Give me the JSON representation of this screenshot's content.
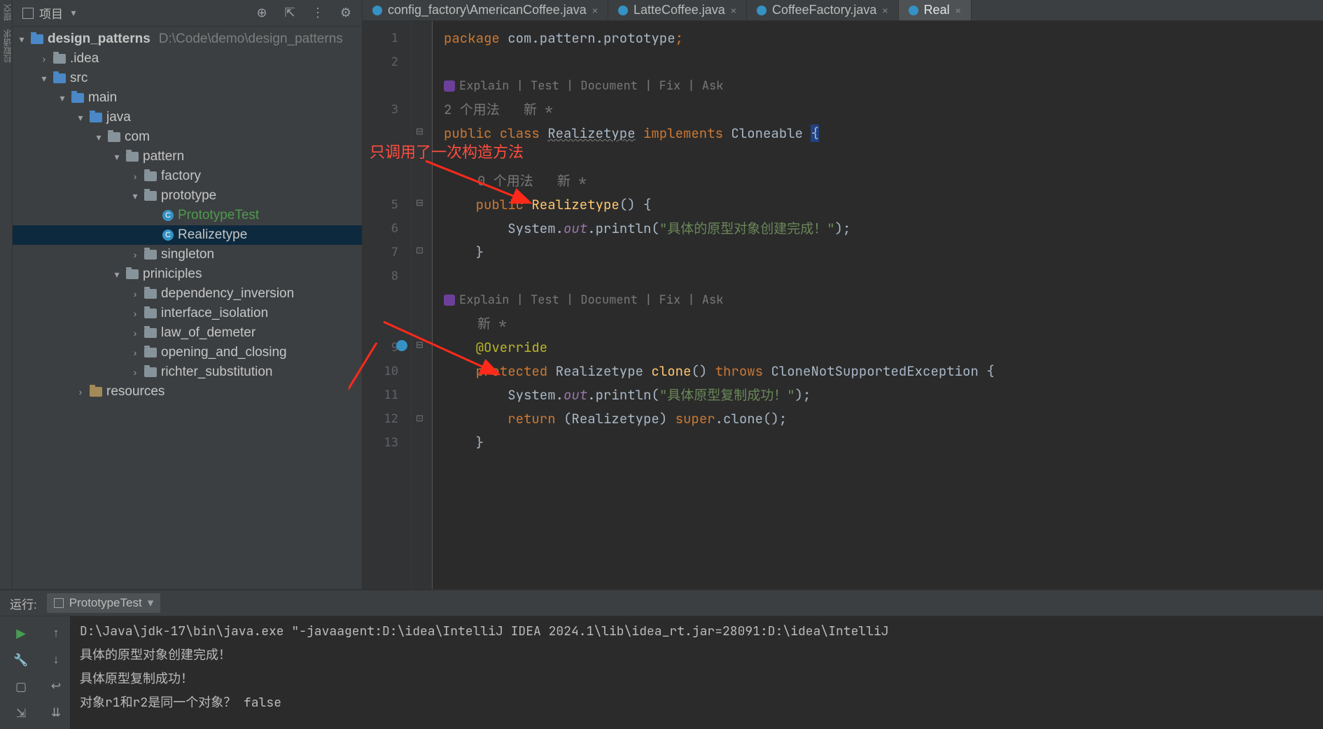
{
  "projectToolbar": {
    "title": "项目"
  },
  "projectTree": {
    "root": {
      "name": "design_patterns",
      "path": "D:\\Code\\demo\\design_patterns"
    },
    "items": [
      {
        "depth": 1,
        "chev": ">",
        "type": "folder",
        "name": ".idea"
      },
      {
        "depth": 1,
        "chev": "v",
        "type": "folder-blue",
        "name": "src"
      },
      {
        "depth": 2,
        "chev": "v",
        "type": "folder-blue",
        "name": "main"
      },
      {
        "depth": 3,
        "chev": "v",
        "type": "folder-blue",
        "name": "java"
      },
      {
        "depth": 4,
        "chev": "v",
        "type": "folder",
        "name": "com"
      },
      {
        "depth": 5,
        "chev": "v",
        "type": "folder",
        "name": "pattern"
      },
      {
        "depth": 6,
        "chev": ">",
        "type": "folder",
        "name": "factory"
      },
      {
        "depth": 6,
        "chev": "v",
        "type": "folder",
        "name": "prototype"
      },
      {
        "depth": 7,
        "chev": "",
        "type": "class",
        "name": "PrototypeTest",
        "style": "green"
      },
      {
        "depth": 7,
        "chev": "",
        "type": "class",
        "name": "Realizetype",
        "selected": true
      },
      {
        "depth": 6,
        "chev": ">",
        "type": "folder",
        "name": "singleton"
      },
      {
        "depth": 5,
        "chev": "v",
        "type": "folder",
        "name": "priniciples"
      },
      {
        "depth": 6,
        "chev": ">",
        "type": "folder",
        "name": "dependency_inversion"
      },
      {
        "depth": 6,
        "chev": ">",
        "type": "folder",
        "name": "interface_isolation"
      },
      {
        "depth": 6,
        "chev": ">",
        "type": "folder",
        "name": "law_of_demeter"
      },
      {
        "depth": 6,
        "chev": ">",
        "type": "folder",
        "name": "opening_and_closing"
      },
      {
        "depth": 6,
        "chev": ">",
        "type": "folder",
        "name": "richter_substitution"
      },
      {
        "depth": 3,
        "chev": ">",
        "type": "folder-res",
        "name": "resources"
      }
    ]
  },
  "tabs": [
    {
      "label": "config_factory\\AmericanCoffee.java",
      "active": false
    },
    {
      "label": "LatteCoffee.java",
      "active": false
    },
    {
      "label": "CoffeeFactory.java",
      "active": false
    },
    {
      "label": "Real",
      "active": true
    }
  ],
  "ai": {
    "actions": "Explain | Test | Document | Fix | Ask"
  },
  "hints": {
    "classUsage": "2 个用法   新 *",
    "ctorUsage": "0 个用法   新 *",
    "cloneHint": "新 *"
  },
  "code": {
    "l1": "package com.pattern.prototype;",
    "l3_pre": "public class ",
    "l3_cls": "Realizetype",
    "l3_mid": " implements ",
    "l3_if": "Cloneable",
    "l3_brace": "{",
    "l5": "    public Realizetype() {",
    "l6a": "        System.",
    "l6b": "out",
    "l6c": ".println(",
    "l6d": "\"具体的原型对象创建完成！\"",
    "l6e": ");",
    "l7": "    }",
    "l9": "    @Override",
    "l10_a": "    protected ",
    "l10_b": "Realizetype ",
    "l10_c": "clone",
    "l10_d": "() ",
    "l10_e": "throws ",
    "l10_f": "CloneNotSupportedException {",
    "l11a": "        System.",
    "l11b": "out",
    "l11c": ".println(",
    "l11d": "\"具体原型复制成功！\"",
    "l11e": ");",
    "l12": "        return (Realizetype) super.clone();",
    "l13": "    }"
  },
  "lineNumbers": [
    "1",
    "2",
    "",
    "3",
    "",
    "",
    "",
    "5",
    "6",
    "7",
    "8",
    "",
    "",
    "9",
    "10",
    "11",
    "12",
    "13"
  ],
  "annotation": {
    "text": "只调用了一次构造方法"
  },
  "run": {
    "label": "运行:",
    "tab": "PrototypeTest",
    "lines": [
      "D:\\Java\\jdk-17\\bin\\java.exe \"-javaagent:D:\\idea\\IntelliJ IDEA 2024.1\\lib\\idea_rt.jar=28091:D:\\idea\\IntelliJ ",
      "具体的原型对象创建完成！",
      "具体原型复制成功！",
      "对象r1和r2是同一个对象？ false"
    ]
  }
}
